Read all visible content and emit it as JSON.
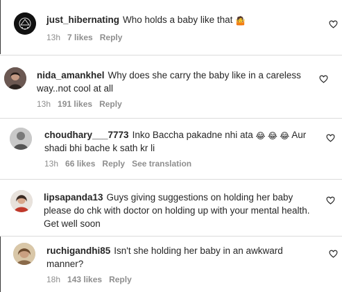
{
  "comments": [
    {
      "username": "just_hibernating",
      "text": "Who holds a baby like that",
      "emoji": "🤷",
      "time": "13h",
      "likes": "7 likes",
      "reply": "Reply"
    },
    {
      "username": "nida_amankhel",
      "text": "Why does she carry the baby like in a careless way..not cool at all",
      "time": "13h",
      "likes": "191 likes",
      "reply": "Reply"
    },
    {
      "username": "choudhary___7773",
      "text_before": "Inko Baccha pakadne nhi ata",
      "emoji": "😂 😂 😂",
      "text_after": "Aur shadi bhi bache k sath kr li",
      "time": "13h",
      "likes": "66 likes",
      "reply": "Reply",
      "translation": "See translation"
    },
    {
      "username": "lipsapanda13",
      "text": "Guys giving suggestions on holding her baby please do chk with doctor on holding up with your mental health. Get well soon"
    },
    {
      "username": "ruchigandhi85",
      "text": "Isn't she holding her baby in an awkward manner?",
      "time": "18h",
      "likes": "143 likes",
      "reply": "Reply"
    }
  ],
  "icons": {
    "like": "heart-icon"
  },
  "colors": {
    "text": "#262626",
    "meta": "#8e8e8e",
    "divider": "#dbdbdb"
  }
}
